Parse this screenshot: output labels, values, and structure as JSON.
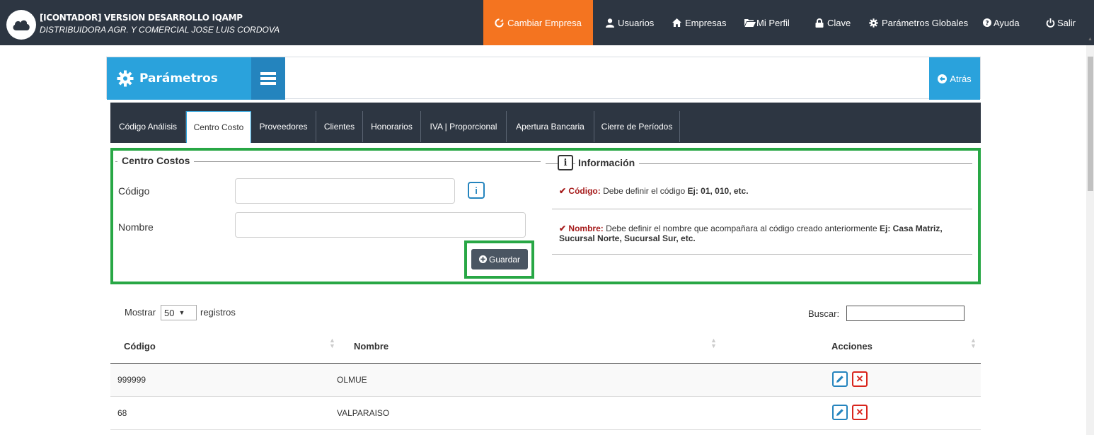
{
  "app": {
    "title": "[ICONTADOR] VERSION DESARROLLO IQAMP",
    "company": "DISTRIBUIDORA AGR. Y COMERCIAL JOSE LUIS CORDOVA"
  },
  "nav": {
    "cambiar_empresa": "Cambiar Empresa",
    "usuarios": "Usuarios",
    "empresas": "Empresas",
    "mi_perfil": "Mi Perfil",
    "clave": "Clave",
    "parametros_globales": "Parámetros Globales",
    "ayuda": "Ayuda",
    "salir": "Salir"
  },
  "header": {
    "title": "Parámetros",
    "back": "Atrás"
  },
  "tabs": [
    {
      "label": "Código Análisis"
    },
    {
      "label": "Centro Costo"
    },
    {
      "label": "Proveedores"
    },
    {
      "label": "Clientes"
    },
    {
      "label": "Honorarios"
    },
    {
      "label": "IVA | Proporcional"
    },
    {
      "label": "Apertura Bancaria"
    },
    {
      "label": "Cierre de Períodos"
    }
  ],
  "form": {
    "legend": "Centro Costos",
    "codigo_label": "Código",
    "codigo_value": "",
    "nombre_label": "Nombre",
    "nombre_value": "",
    "save": "Guardar"
  },
  "info": {
    "legend": "Información",
    "badge": "i",
    "item1_key": "Código:",
    "item1_text": "Debe definir el código",
    "item1_example": "Ej: 01, 010, etc.",
    "item2_key": "Nombre:",
    "item2_text": "Debe definir el nombre que acompañara al código creado anteriormente",
    "item2_example": "Ej: Casa Matriz, Sucursal Norte, Sucursal Sur, etc."
  },
  "table": {
    "show_prefix": "Mostrar",
    "show_value": "50",
    "show_suffix": "registros",
    "search_label": "Buscar:",
    "search_value": "",
    "columns": [
      "Código",
      "Nombre",
      "Acciones"
    ],
    "rows": [
      {
        "codigo": "999999",
        "nombre": "OLMUE"
      },
      {
        "codigo": "68",
        "nombre": "VALPARAISO"
      }
    ]
  },
  "colors": {
    "topbar": "#2d3642",
    "accent_orange": "#f47420",
    "accent_blue": "#2aa2dc",
    "highlight_green": "#28a745",
    "danger_red": "#d9251c"
  }
}
